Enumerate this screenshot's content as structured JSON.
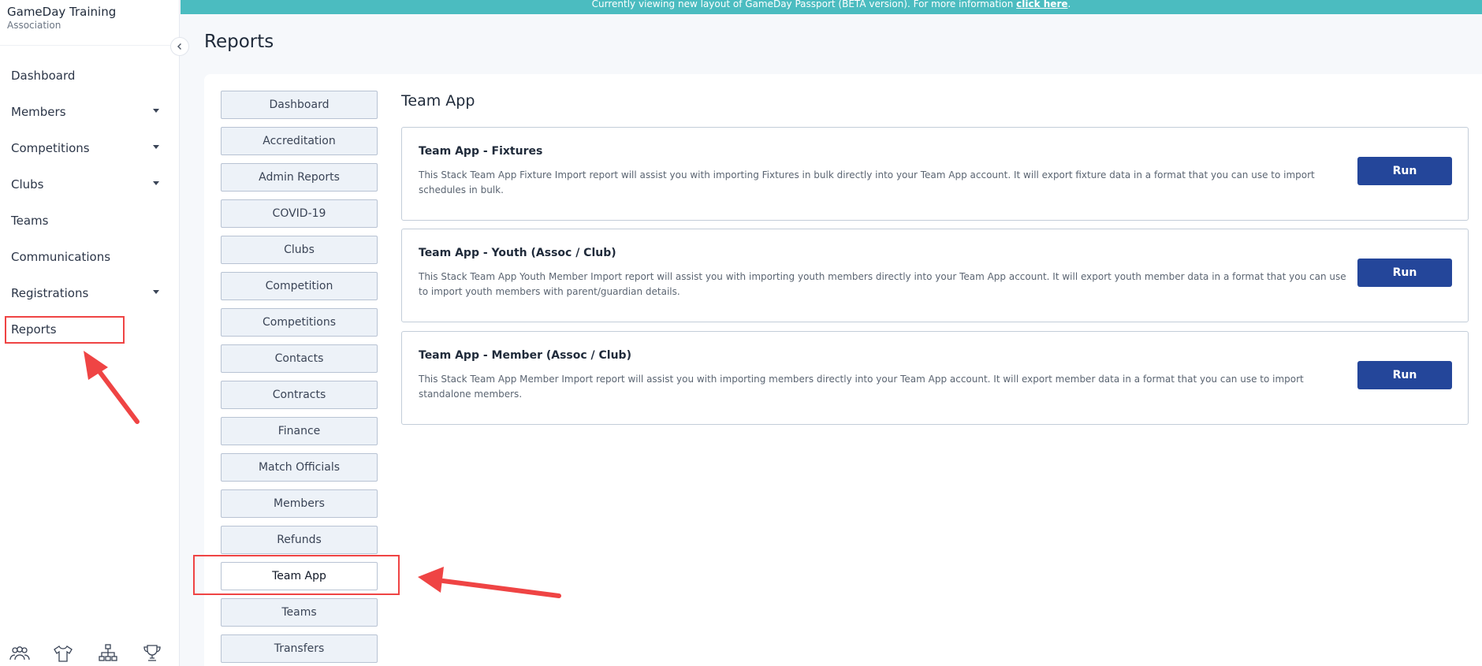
{
  "org": {
    "name": "GameDay Training",
    "type": "Association"
  },
  "banner": {
    "text": "Currently viewing new layout of GameDay Passport (BETA version). For more information ",
    "link": "click here",
    "suffix": "."
  },
  "page": {
    "title": "Reports"
  },
  "nav": {
    "items": [
      {
        "label": "Dashboard"
      },
      {
        "label": "Members"
      },
      {
        "label": "Competitions"
      },
      {
        "label": "Clubs"
      },
      {
        "label": "Teams"
      },
      {
        "label": "Communications"
      },
      {
        "label": "Registrations"
      },
      {
        "label": "Reports"
      }
    ]
  },
  "bottom_icons": [
    "members-icon",
    "jersey-icon",
    "hierarchy-icon",
    "trophy-icon"
  ],
  "report_menu": {
    "items": [
      {
        "label": "Dashboard"
      },
      {
        "label": "Accreditation"
      },
      {
        "label": "Admin Reports"
      },
      {
        "label": "COVID-19"
      },
      {
        "label": "Clubs"
      },
      {
        "label": "Competition"
      },
      {
        "label": "Competitions"
      },
      {
        "label": "Contacts"
      },
      {
        "label": "Contracts"
      },
      {
        "label": "Finance"
      },
      {
        "label": "Match Officials"
      },
      {
        "label": "Members"
      },
      {
        "label": "Refunds"
      },
      {
        "label": "Team App"
      },
      {
        "label": "Teams"
      },
      {
        "label": "Transfers"
      }
    ],
    "active": "Team App"
  },
  "section": {
    "title": "Team App"
  },
  "reports": [
    {
      "title": "Team App - Fixtures",
      "description": "This Stack Team App Fixture Import report will assist you with importing Fixtures in bulk directly into your Team App account. It will export fixture data in a format that you can use to import schedules in bulk.",
      "action": "Run"
    },
    {
      "title": "Team App - Youth (Assoc / Club)",
      "description": "This Stack Team App Youth Member Import report will assist you with importing youth members directly into your Team App account. It will export youth member data in a format that you can use to import youth members with parent/guardian details.",
      "action": "Run"
    },
    {
      "title": "Team App - Member (Assoc / Club)",
      "description": "This Stack Team App Member Import report will assist you with importing members directly into your Team App account. It will export member data in a format that you can use to import standalone members.",
      "action": "Run"
    }
  ],
  "colors": {
    "banner": "#4bbcc0",
    "run_button": "#24469a",
    "highlight": "#ef4444"
  }
}
